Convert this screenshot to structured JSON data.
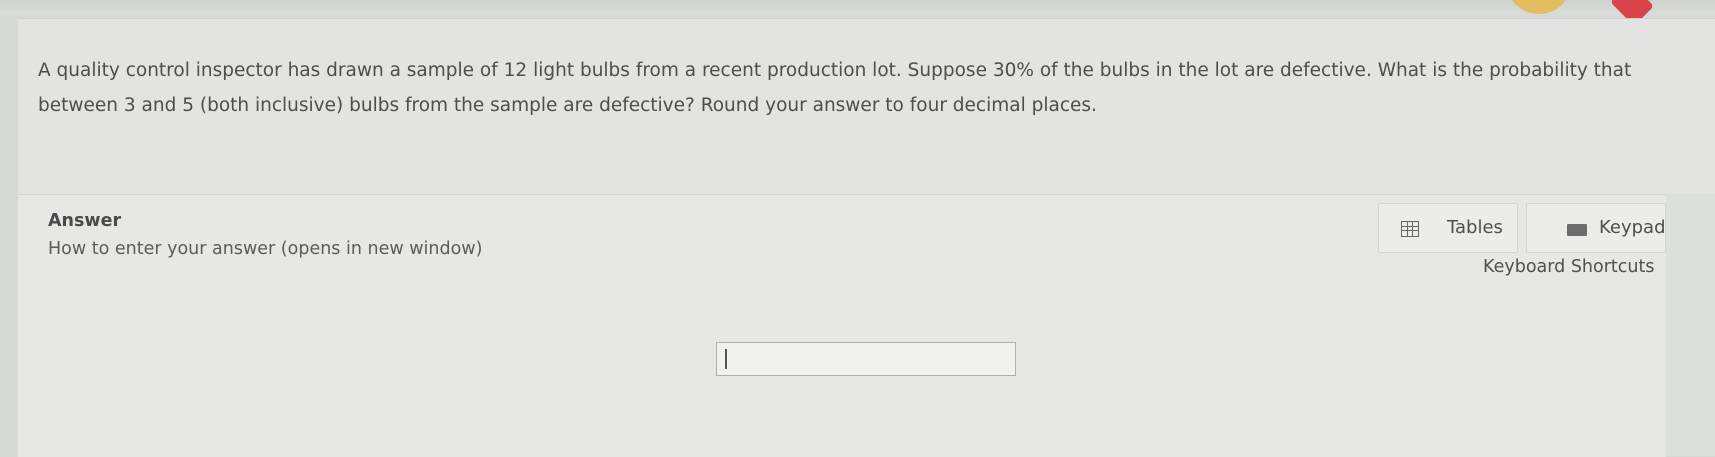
{
  "question": {
    "text": "A quality control inspector has drawn a sample of 12 light bulbs from a recent production lot. Suppose 30% of the bulbs in the lot are defective. What is the probability that between 3 and 5 (both inclusive) bulbs from the sample are defective? Round your answer to four decimal places."
  },
  "answer": {
    "label": "Answer",
    "help_link": "How to enter your answer (opens in new window)",
    "input_value": ""
  },
  "toolbar": {
    "tables_label": "Tables",
    "tables_icon": "table-icon",
    "keypad_label": "Keypad",
    "keypad_icon": "keyboard-icon",
    "shortcuts_label": "Keyboard Shortcuts"
  },
  "colors": {
    "background": "#d7dad6",
    "text": "#4d4d4d"
  }
}
